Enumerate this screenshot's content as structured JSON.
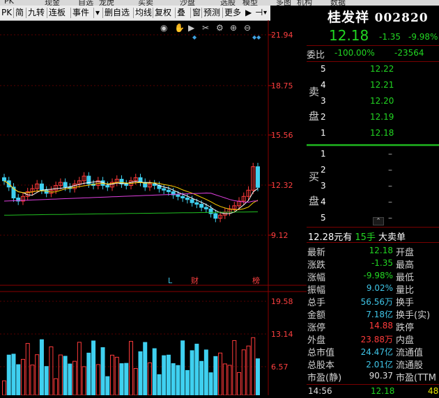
{
  "top_strip": [
    "PK",
    "现金",
    "自选",
    "龙虎",
    "买卖",
    "沙盘",
    "选股",
    "模型",
    "多图",
    "机构",
    "数据"
  ],
  "toolbar": {
    "items": [
      "PK",
      "简",
      "九转",
      "连板",
      "事件",
      "▾",
      "删自选",
      "均线",
      "复权",
      "叠",
      "窗",
      "预测",
      "更多"
    ],
    "icons": [
      "eye-icon",
      "hand-icon",
      "play-icon",
      "scissors-icon",
      "gear-icon",
      "zoom-in-icon",
      "zoom-out-icon"
    ]
  },
  "stock": {
    "name": "桂发祥",
    "code": "002820",
    "price": "12.18",
    "change": "-1.35",
    "change_pct": "-9.98%"
  },
  "weibi": {
    "label": "委比",
    "pct": "-100.00%",
    "diff": "-23564"
  },
  "sell_label": [
    "卖",
    "盘"
  ],
  "buy_label": [
    "买",
    "盘"
  ],
  "sell_rows": [
    {
      "level": "5",
      "price": "12.22",
      "vol": ""
    },
    {
      "level": "4",
      "price": "12.21",
      "vol": ""
    },
    {
      "level": "3",
      "price": "12.20",
      "vol": ""
    },
    {
      "level": "2",
      "price": "12.19",
      "vol": ""
    },
    {
      "level": "1",
      "price": "12.18",
      "vol": ""
    }
  ],
  "buy_rows": [
    {
      "level": "1",
      "price": "–",
      "vol": ""
    },
    {
      "level": "2",
      "price": "–",
      "vol": ""
    },
    {
      "level": "3",
      "price": "–",
      "vol": ""
    },
    {
      "level": "4",
      "price": "–",
      "vol": ""
    },
    {
      "level": "5",
      "price": "–",
      "vol": ""
    }
  ],
  "order_note": {
    "text": "12.28元有",
    "qty": "15手",
    "tag": "大卖单"
  },
  "stats": [
    {
      "l": "最新",
      "v": "12.18",
      "r": "开盘",
      "c": "green"
    },
    {
      "l": "涨跌",
      "v": "-1.35",
      "r": "最高",
      "c": "green"
    },
    {
      "l": "涨幅",
      "v": "-9.98%",
      "r": "最低",
      "c": "green"
    },
    {
      "l": "振幅",
      "v": "9.02%",
      "r": "量比",
      "c": "cyan"
    },
    {
      "l": "总手",
      "v": "56.56万",
      "r": "换手",
      "c": "cyan"
    },
    {
      "l": "金额",
      "v": "7.18亿",
      "r": "换手(实)",
      "c": "cyan"
    },
    {
      "l": "涨停",
      "v": "14.88",
      "r": "跌停",
      "c": "red"
    },
    {
      "l": "外盘",
      "v": "23.88万",
      "r": "内盘",
      "c": "red"
    },
    {
      "l": "总市值",
      "v": "24.47亿",
      "r": "流通值",
      "c": "cyan"
    },
    {
      "l": "总股本",
      "v": "2.01亿",
      "r": "流通股",
      "c": "cyan"
    },
    {
      "l": "市盈(静)",
      "v": "90.37",
      "r": "市盈(TTM",
      "c": "wht"
    }
  ],
  "tick_row": {
    "time": "14:56",
    "price": "12.18",
    "vol": "48"
  },
  "chart_data": {
    "type": "candlestick",
    "price_ticks": [
      "21.94",
      "18.75",
      "15.56",
      "12.32",
      "9.12"
    ],
    "volume_ticks": [
      "19.58",
      "13.14",
      "6.57"
    ],
    "markers": [
      "L",
      "财",
      "榜"
    ]
  }
}
